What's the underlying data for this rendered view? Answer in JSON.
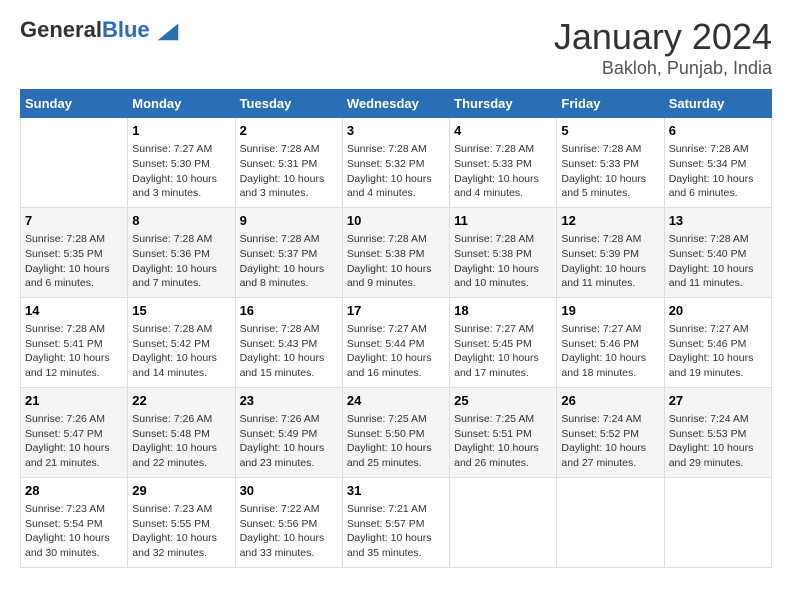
{
  "logo": {
    "general": "General",
    "blue": "Blue"
  },
  "header": {
    "month": "January 2024",
    "location": "Bakloh, Punjab, India"
  },
  "weekdays": [
    "Sunday",
    "Monday",
    "Tuesday",
    "Wednesday",
    "Thursday",
    "Friday",
    "Saturday"
  ],
  "weeks": [
    [
      {
        "day": "",
        "text": ""
      },
      {
        "day": "1",
        "text": "Sunrise: 7:27 AM\nSunset: 5:30 PM\nDaylight: 10 hours\nand 3 minutes."
      },
      {
        "day": "2",
        "text": "Sunrise: 7:28 AM\nSunset: 5:31 PM\nDaylight: 10 hours\nand 3 minutes."
      },
      {
        "day": "3",
        "text": "Sunrise: 7:28 AM\nSunset: 5:32 PM\nDaylight: 10 hours\nand 4 minutes."
      },
      {
        "day": "4",
        "text": "Sunrise: 7:28 AM\nSunset: 5:33 PM\nDaylight: 10 hours\nand 4 minutes."
      },
      {
        "day": "5",
        "text": "Sunrise: 7:28 AM\nSunset: 5:33 PM\nDaylight: 10 hours\nand 5 minutes."
      },
      {
        "day": "6",
        "text": "Sunrise: 7:28 AM\nSunset: 5:34 PM\nDaylight: 10 hours\nand 6 minutes."
      }
    ],
    [
      {
        "day": "7",
        "text": "Sunrise: 7:28 AM\nSunset: 5:35 PM\nDaylight: 10 hours\nand 6 minutes."
      },
      {
        "day": "8",
        "text": "Sunrise: 7:28 AM\nSunset: 5:36 PM\nDaylight: 10 hours\nand 7 minutes."
      },
      {
        "day": "9",
        "text": "Sunrise: 7:28 AM\nSunset: 5:37 PM\nDaylight: 10 hours\nand 8 minutes."
      },
      {
        "day": "10",
        "text": "Sunrise: 7:28 AM\nSunset: 5:38 PM\nDaylight: 10 hours\nand 9 minutes."
      },
      {
        "day": "11",
        "text": "Sunrise: 7:28 AM\nSunset: 5:38 PM\nDaylight: 10 hours\nand 10 minutes."
      },
      {
        "day": "12",
        "text": "Sunrise: 7:28 AM\nSunset: 5:39 PM\nDaylight: 10 hours\nand 11 minutes."
      },
      {
        "day": "13",
        "text": "Sunrise: 7:28 AM\nSunset: 5:40 PM\nDaylight: 10 hours\nand 11 minutes."
      }
    ],
    [
      {
        "day": "14",
        "text": "Sunrise: 7:28 AM\nSunset: 5:41 PM\nDaylight: 10 hours\nand 12 minutes."
      },
      {
        "day": "15",
        "text": "Sunrise: 7:28 AM\nSunset: 5:42 PM\nDaylight: 10 hours\nand 14 minutes."
      },
      {
        "day": "16",
        "text": "Sunrise: 7:28 AM\nSunset: 5:43 PM\nDaylight: 10 hours\nand 15 minutes."
      },
      {
        "day": "17",
        "text": "Sunrise: 7:27 AM\nSunset: 5:44 PM\nDaylight: 10 hours\nand 16 minutes."
      },
      {
        "day": "18",
        "text": "Sunrise: 7:27 AM\nSunset: 5:45 PM\nDaylight: 10 hours\nand 17 minutes."
      },
      {
        "day": "19",
        "text": "Sunrise: 7:27 AM\nSunset: 5:46 PM\nDaylight: 10 hours\nand 18 minutes."
      },
      {
        "day": "20",
        "text": "Sunrise: 7:27 AM\nSunset: 5:46 PM\nDaylight: 10 hours\nand 19 minutes."
      }
    ],
    [
      {
        "day": "21",
        "text": "Sunrise: 7:26 AM\nSunset: 5:47 PM\nDaylight: 10 hours\nand 21 minutes."
      },
      {
        "day": "22",
        "text": "Sunrise: 7:26 AM\nSunset: 5:48 PM\nDaylight: 10 hours\nand 22 minutes."
      },
      {
        "day": "23",
        "text": "Sunrise: 7:26 AM\nSunset: 5:49 PM\nDaylight: 10 hours\nand 23 minutes."
      },
      {
        "day": "24",
        "text": "Sunrise: 7:25 AM\nSunset: 5:50 PM\nDaylight: 10 hours\nand 25 minutes."
      },
      {
        "day": "25",
        "text": "Sunrise: 7:25 AM\nSunset: 5:51 PM\nDaylight: 10 hours\nand 26 minutes."
      },
      {
        "day": "26",
        "text": "Sunrise: 7:24 AM\nSunset: 5:52 PM\nDaylight: 10 hours\nand 27 minutes."
      },
      {
        "day": "27",
        "text": "Sunrise: 7:24 AM\nSunset: 5:53 PM\nDaylight: 10 hours\nand 29 minutes."
      }
    ],
    [
      {
        "day": "28",
        "text": "Sunrise: 7:23 AM\nSunset: 5:54 PM\nDaylight: 10 hours\nand 30 minutes."
      },
      {
        "day": "29",
        "text": "Sunrise: 7:23 AM\nSunset: 5:55 PM\nDaylight: 10 hours\nand 32 minutes."
      },
      {
        "day": "30",
        "text": "Sunrise: 7:22 AM\nSunset: 5:56 PM\nDaylight: 10 hours\nand 33 minutes."
      },
      {
        "day": "31",
        "text": "Sunrise: 7:21 AM\nSunset: 5:57 PM\nDaylight: 10 hours\nand 35 minutes."
      },
      {
        "day": "",
        "text": ""
      },
      {
        "day": "",
        "text": ""
      },
      {
        "day": "",
        "text": ""
      }
    ]
  ]
}
